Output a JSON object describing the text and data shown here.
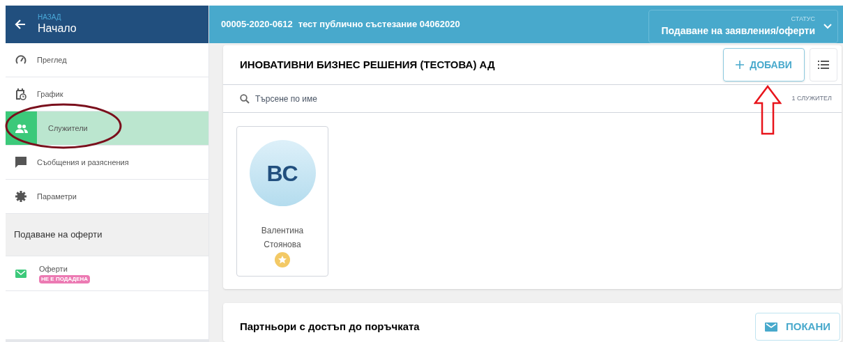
{
  "back": {
    "label": "НАЗАД",
    "title": "Начало"
  },
  "sidebar": {
    "items": [
      {
        "label": "Преглед",
        "kind": "gauge",
        "selected": false
      },
      {
        "label": "График",
        "kind": "calendar",
        "selected": false
      },
      {
        "label": "Служители",
        "kind": "people",
        "selected": true
      },
      {
        "label": "Съобщения и разяснения",
        "kind": "chat",
        "selected": false
      },
      {
        "label": "Параметри",
        "kind": "gear",
        "selected": false
      }
    ],
    "section": "Подаване на оферти",
    "section_items": [
      {
        "label": "Оферти",
        "badge": "НЕ Е ПОДАДЕНА",
        "kind": "mail"
      }
    ]
  },
  "header": {
    "code": "00005-2020-0612",
    "title": "тест публично състезание 04062020",
    "status_label": "СТАТУС",
    "status": "Подаване на заявления/оферти"
  },
  "company": {
    "name": "ИНОВАТИВНИ БИЗНЕС РЕШЕНИЯ (ТЕСТОВА) АД",
    "add_button": "ДОБАВИ",
    "search_placeholder": "Търсене по име",
    "count": "1 СЛУЖИТЕЛ",
    "employees": [
      {
        "initials": "ВС",
        "first_name": "Валентина",
        "last_name": "Стоянова",
        "starred": true
      }
    ]
  },
  "partners": {
    "title": "Партньори с достъп до поръчката",
    "invite_button": "ПОКАНИ"
  },
  "annotations": [
    {
      "kind": "ellipse"
    },
    {
      "kind": "arrow"
    }
  ]
}
